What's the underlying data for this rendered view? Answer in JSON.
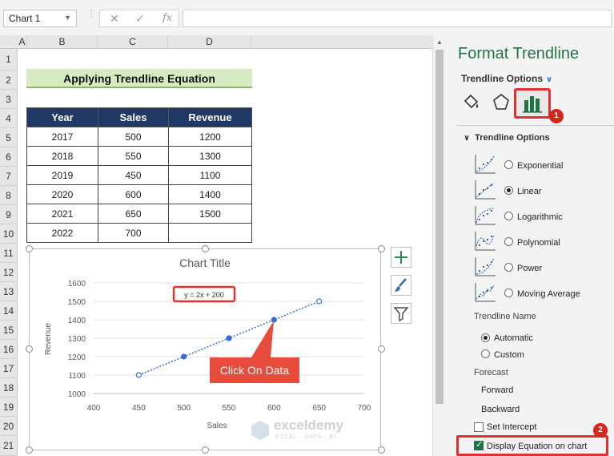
{
  "name_box": {
    "value": "Chart 1"
  },
  "formula_bar": {
    "fx": "fx",
    "cancel": "✕",
    "enter": "✓"
  },
  "columns": [
    "A",
    "B",
    "C",
    "D"
  ],
  "rows": [
    "1",
    "2",
    "3",
    "4",
    "5",
    "6",
    "7",
    "8",
    "9",
    "10",
    "11",
    "12",
    "13",
    "14",
    "15",
    "16",
    "17",
    "18",
    "19",
    "20",
    "21"
  ],
  "sheet_title": "Applying Trendline Equation",
  "table": {
    "headers": [
      "Year",
      "Sales",
      "Revenue"
    ],
    "rows": [
      [
        "2017",
        "500",
        "1200"
      ],
      [
        "2018",
        "550",
        "1300"
      ],
      [
        "2019",
        "450",
        "1100"
      ],
      [
        "2020",
        "600",
        "1400"
      ],
      [
        "2021",
        "650",
        "1500"
      ],
      [
        "2022",
        "700",
        ""
      ]
    ]
  },
  "chart_data": {
    "type": "scatter",
    "title": "Chart Title",
    "xlabel": "Sales",
    "ylabel": "Revenue",
    "xlim": [
      400,
      700
    ],
    "ylim": [
      1000,
      1600
    ],
    "x_ticks": [
      "400",
      "450",
      "500",
      "550",
      "600",
      "650",
      "700"
    ],
    "y_ticks": [
      "1000",
      "1100",
      "1200",
      "1300",
      "1400",
      "1500",
      "1600"
    ],
    "points": [
      {
        "x": 450,
        "y": 1100
      },
      {
        "x": 500,
        "y": 1200
      },
      {
        "x": 550,
        "y": 1300
      },
      {
        "x": 600,
        "y": 1400
      },
      {
        "x": 650,
        "y": 1500
      }
    ],
    "trendline": {
      "type": "linear",
      "equation": "y = 2x + 200",
      "slope": 2,
      "intercept": 200
    },
    "grid": true,
    "legend": "none"
  },
  "callout": {
    "text": "Click On Data"
  },
  "pane": {
    "title": "Format Trendline",
    "subtitle": "Trendline Options",
    "section": "Trendline Options",
    "options": [
      "Exponential",
      "Linear",
      "Logarithmic",
      "Polynomial",
      "Power",
      "Moving Average"
    ],
    "selected_option": "Linear",
    "trendline_name_label": "Trendline Name",
    "name_automatic": "Automatic",
    "name_custom": "Custom",
    "forecast_label": "Forecast",
    "forward_label": "Forward",
    "backward_label": "Backward",
    "set_intercept_label": "Set Intercept",
    "display_equation_label": "Display Equation on chart",
    "display_equation_checked": true,
    "badge1": "1",
    "badge2": "2"
  },
  "colors": {
    "accent_green": "#217346",
    "header_navy": "#1f3864",
    "highlight_red": "#e0312f",
    "point_blue": "#4472c4"
  },
  "icons": [
    "paint-bucket-icon",
    "pentagon-icon",
    "bar-chart-icon",
    "chart-elements-plus-icon",
    "chart-styles-brush-icon",
    "chart-filter-icon"
  ],
  "watermark": {
    "name": "exceldemy",
    "tagline": "EXCEL · DATA · BI"
  }
}
